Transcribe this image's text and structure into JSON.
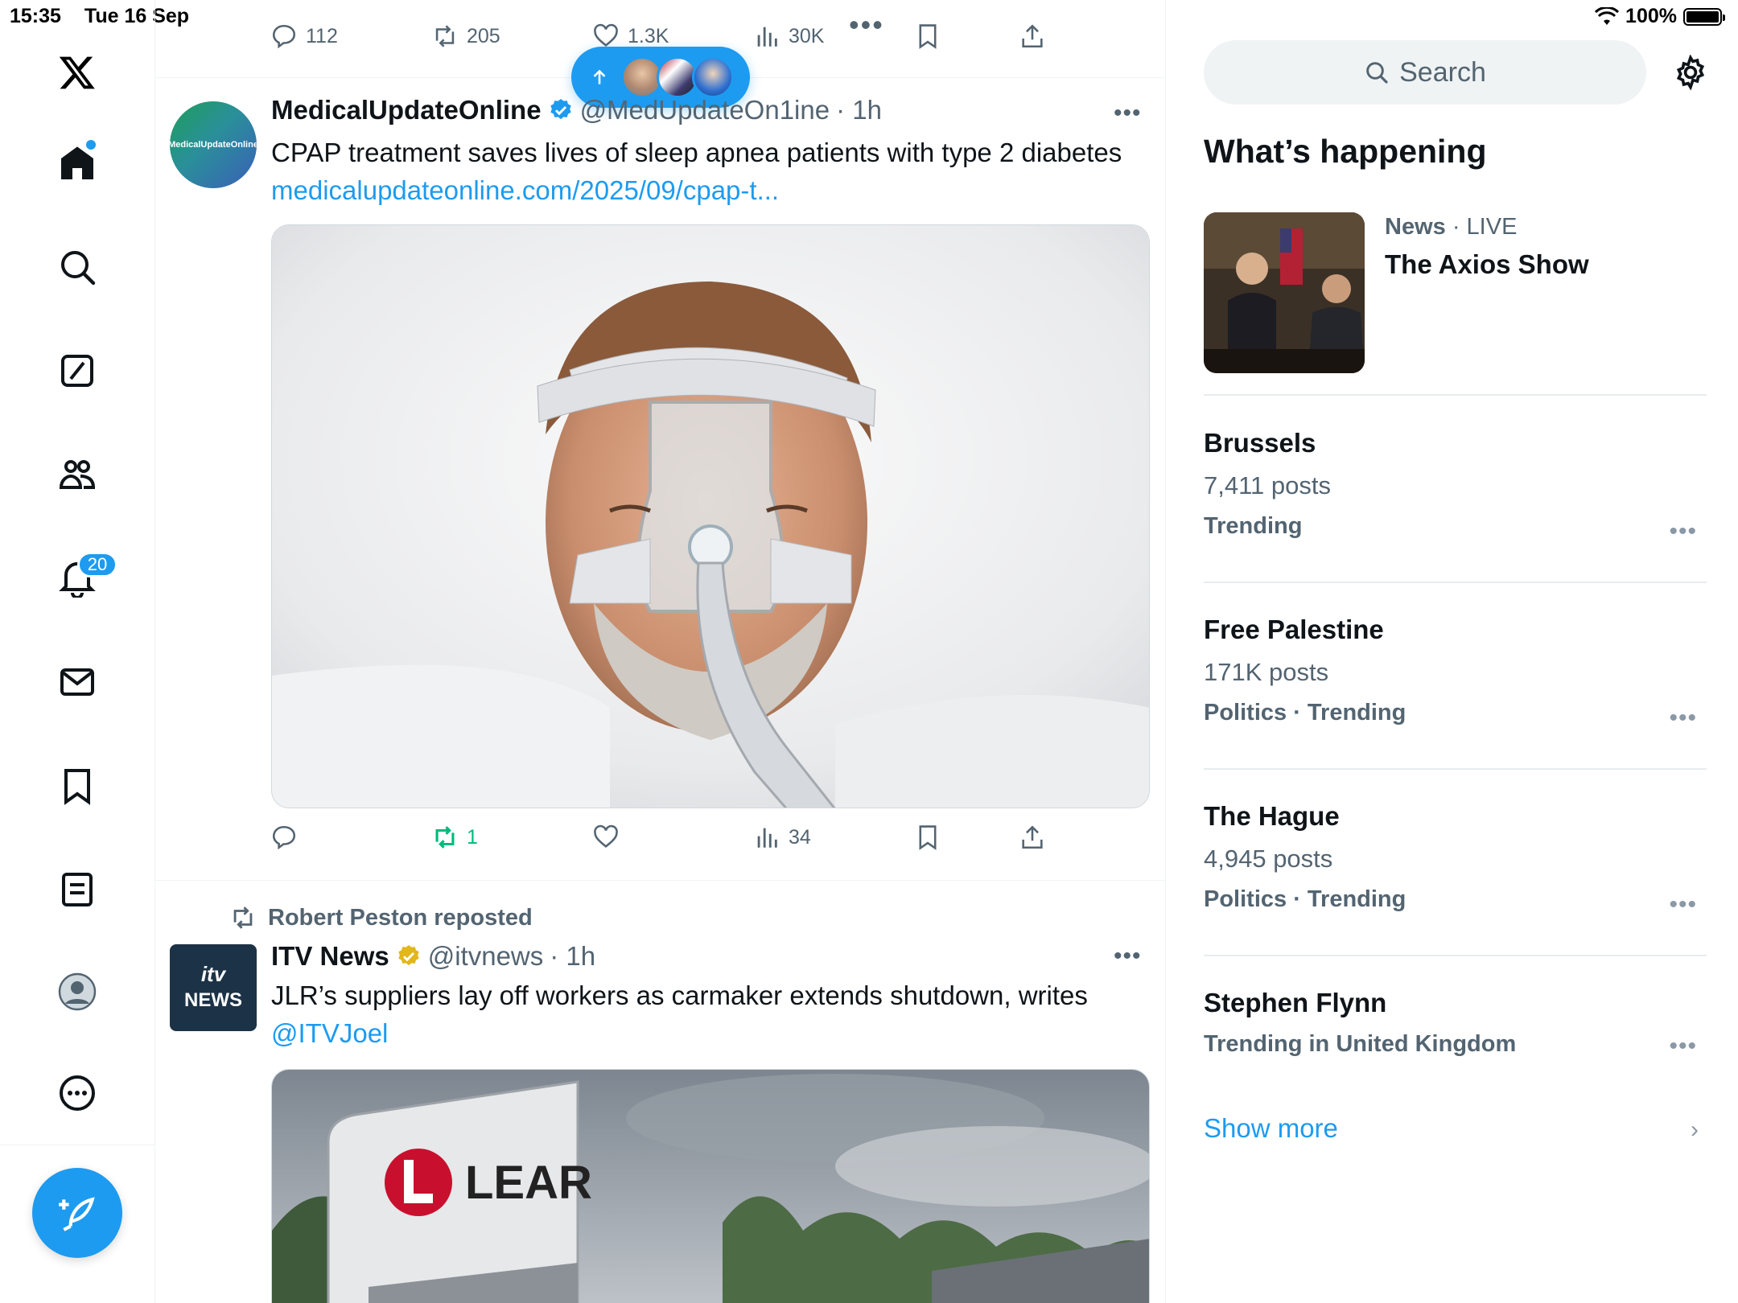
{
  "status_bar": {
    "time": "15:35",
    "date": "Tue 16 Sep",
    "battery": "100%"
  },
  "rail": {
    "notifications_count": "20"
  },
  "top_tweet_actions": {
    "replies": "112",
    "reposts": "205",
    "likes": "1.3K",
    "views": "30K"
  },
  "tweet1": {
    "name": "MedicalUpdateOnline",
    "handle": "@MedUpdateOn1ine",
    "time": "· 1h",
    "avatar_text": "MedicalUpdateOnline",
    "text": "CPAP treatment saves lives of sleep apnea patients with type 2 diabetes ",
    "link": "medicalupdateonline.com/2025/09/cpap-t...",
    "actions": {
      "replies": "",
      "reposts": "1",
      "likes": "",
      "views": "34"
    }
  },
  "tweet2": {
    "repost_by": "Robert Peston reposted",
    "name": "ITV News",
    "handle": "@itvnews",
    "time": "· 1h",
    "avatar_top": "itv",
    "avatar_bottom": "NEWS",
    "text": "JLR’s suppliers lay off workers as carmaker extends shutdown, writes ",
    "mention": "@ITVJoel",
    "image_sign_text": "LEAR"
  },
  "sidebar": {
    "search_placeholder": "Search",
    "section_title": "What’s happening",
    "live": {
      "category": "News",
      "status": "· LIVE",
      "title": "The Axios Show"
    },
    "trends": [
      {
        "name": "Brussels",
        "posts": "7,411 posts",
        "category": "Trending"
      },
      {
        "name": "Free Palestine",
        "posts": "171K posts",
        "category": "Politics · Trending"
      },
      {
        "name": "The Hague",
        "posts": "4,945 posts",
        "category": "Politics · Trending"
      },
      {
        "name": "Stephen Flynn",
        "posts": "",
        "category": "Trending in United Kingdom"
      }
    ],
    "show_more": "Show more"
  },
  "colors": {
    "accent": "#1d9bf0",
    "repost_green": "#00ba7c",
    "secondary_text": "#536471"
  }
}
